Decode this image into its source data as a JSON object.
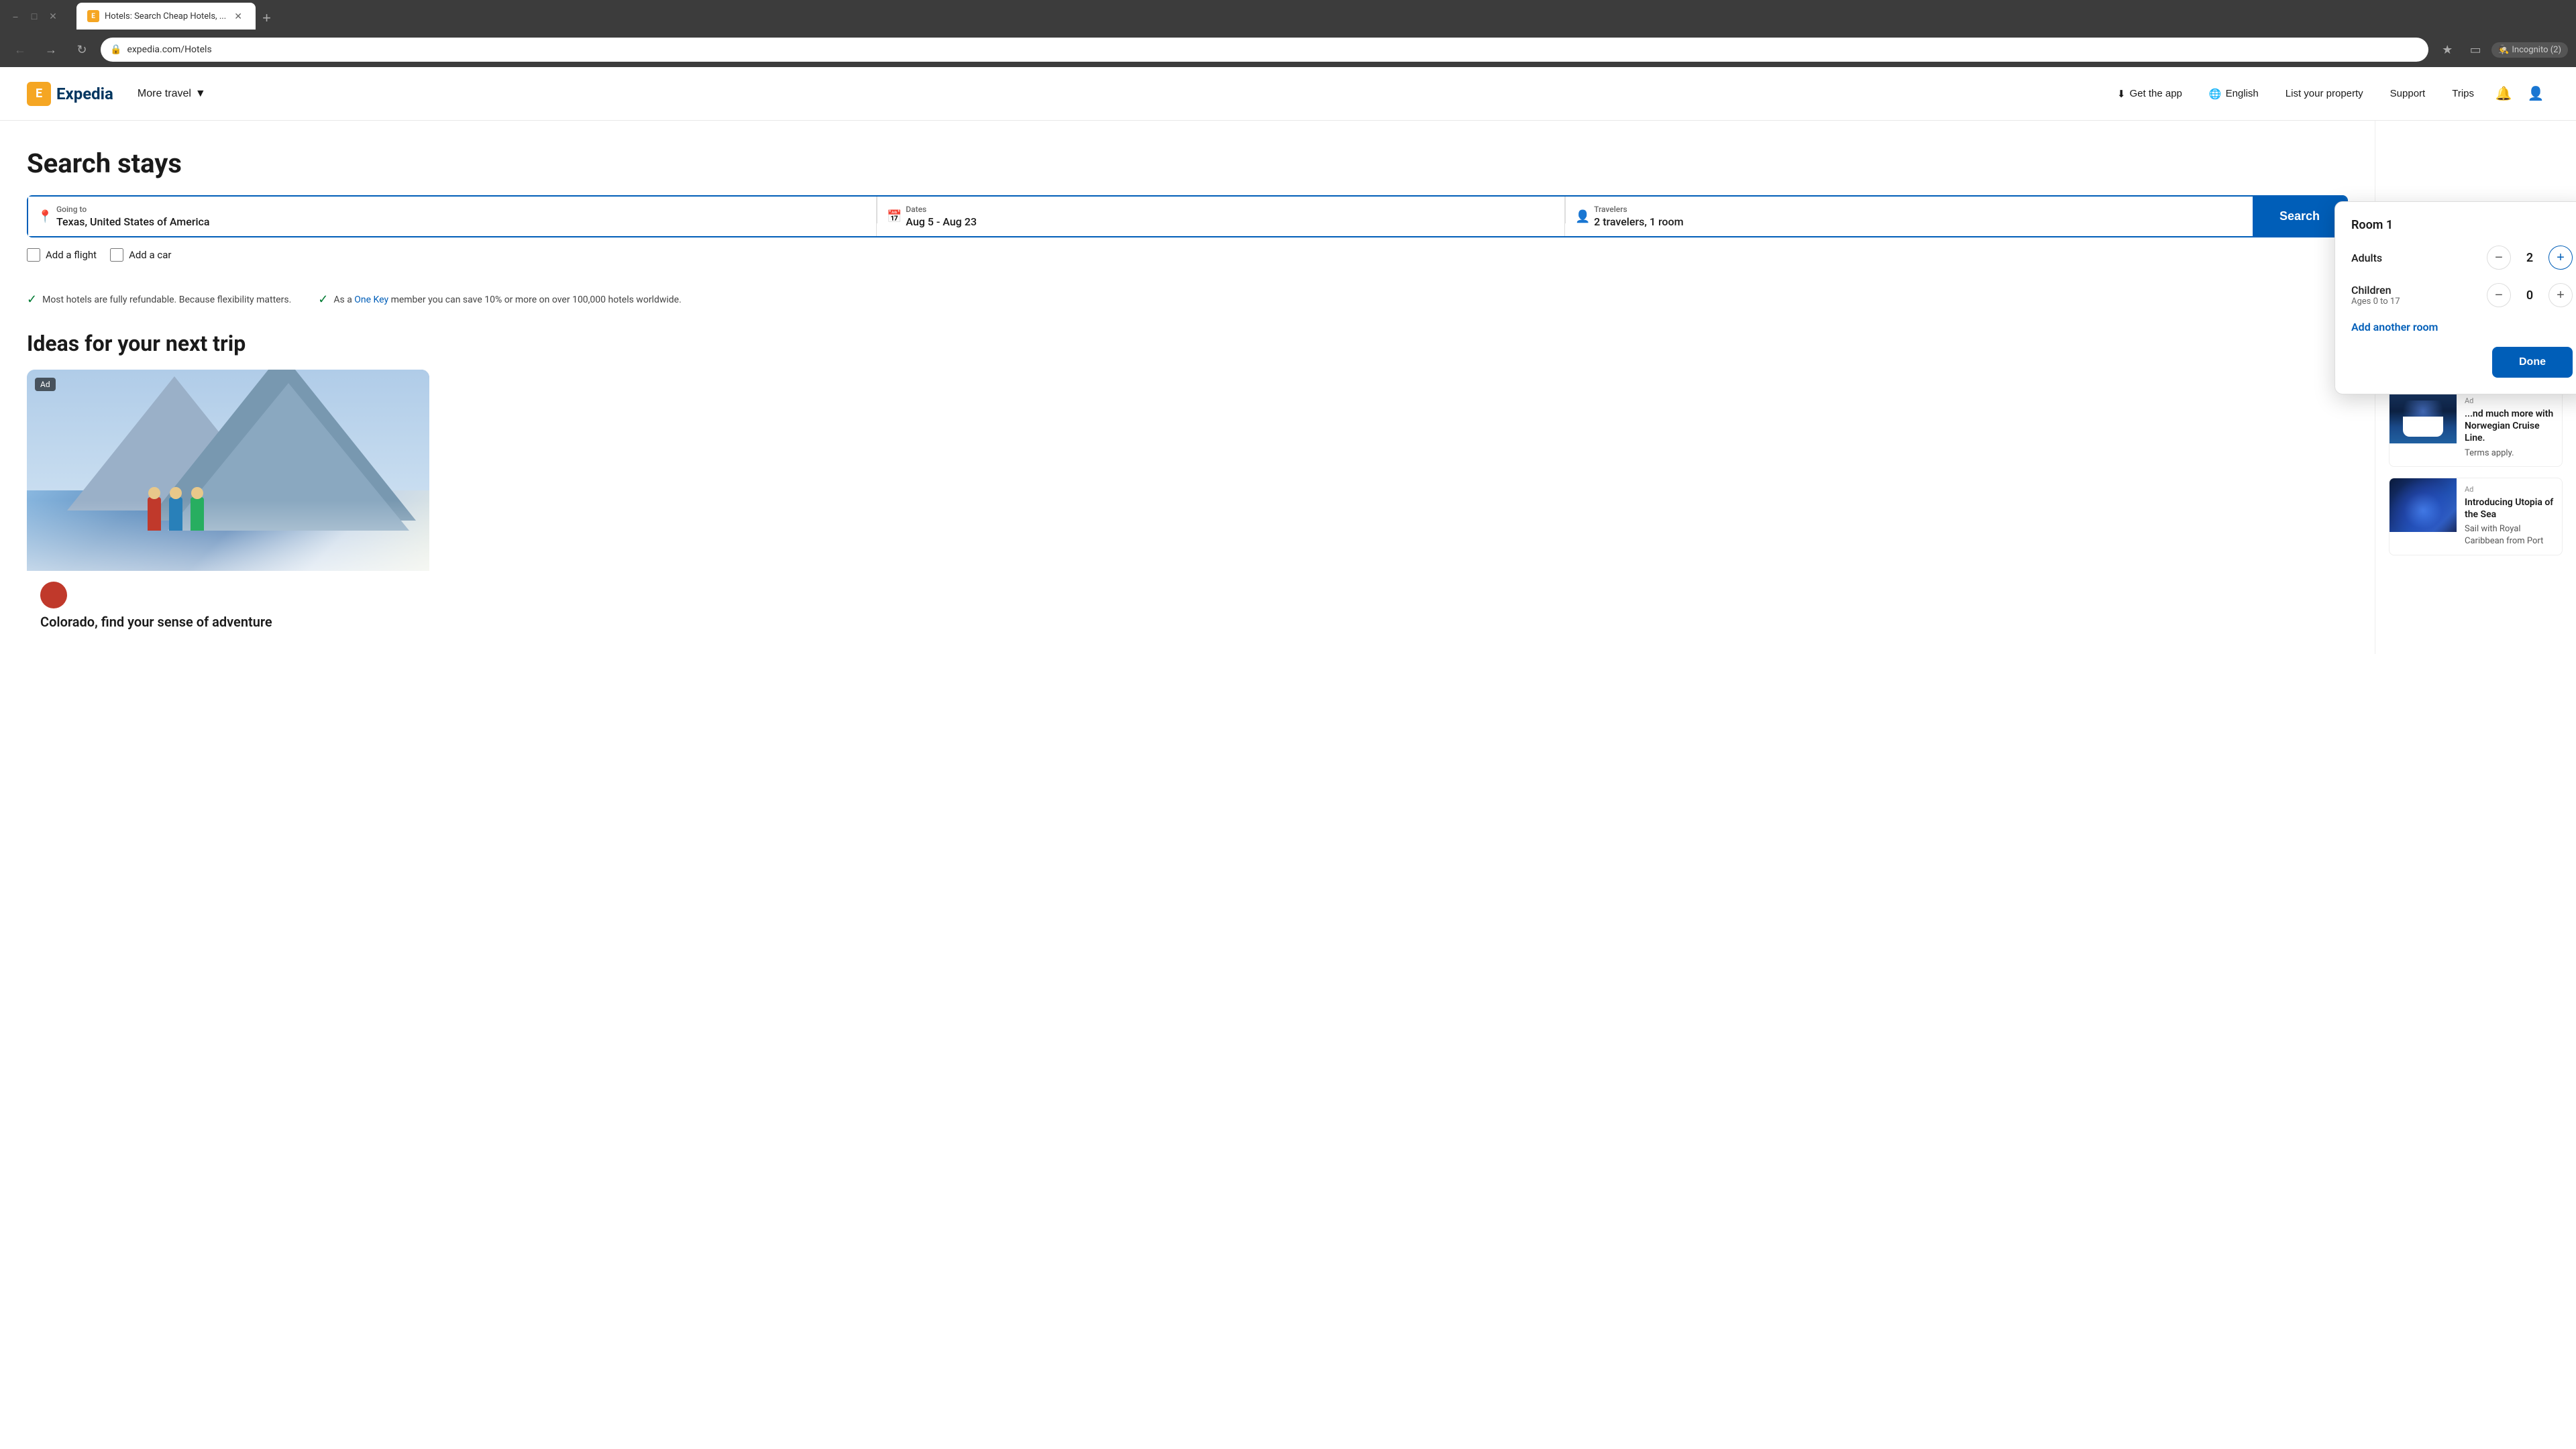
{
  "browser": {
    "tab_title": "Hotels: Search Cheap Hotels, ...",
    "tab_icon": "E",
    "address": "expedia.com/Hotels",
    "incognito_label": "Incognito (2)"
  },
  "header": {
    "logo_text": "Expedia",
    "logo_icon": "E",
    "more_travel": "More travel",
    "get_app": "Get the app",
    "language": "English",
    "list_property": "List your property",
    "support": "Support",
    "trips": "Trips"
  },
  "search": {
    "title": "Search stays",
    "going_to_label": "Going to",
    "going_to_value": "Texas, United States of America",
    "dates_label": "Dates",
    "dates_value": "Aug 5 - Aug 23",
    "travelers_label": "Travelers",
    "travelers_value": "2 travelers, 1 room",
    "search_button": "Search",
    "add_flight_label": "Add a flight",
    "add_car_label": "Add a car"
  },
  "benefits": [
    {
      "text": "Most hotels are fully refundable. Because flexibility matters."
    },
    {
      "text_before": "As a ",
      "link_text": "One Key",
      "text_after": " member you can save 10% or more on over 100,000 hotels worldwide."
    }
  ],
  "ideas": {
    "title": "Ideas for your next trip",
    "card": {
      "ad_badge": "Ad",
      "caption": "Colorado, find your sense of adventure"
    }
  },
  "travelers_popup": {
    "room_label": "Room 1",
    "adults_label": "Adults",
    "adults_value": 2,
    "children_label": "Children",
    "children_sub": "Ages 0 to 17",
    "children_value": 0,
    "add_room_link": "Add another room",
    "done_button": "Done"
  },
  "sidebar": {
    "cards": [
      {
        "type": "cruise",
        "ad": true,
        "title": "...nd much more with Norwegian Cruise Line.",
        "desc": "Terms apply."
      },
      {
        "type": "utopia",
        "ad": true,
        "title": "Introducing Utopia of the Sea",
        "desc": "Sail with Royal Caribbean from Port"
      }
    ]
  }
}
